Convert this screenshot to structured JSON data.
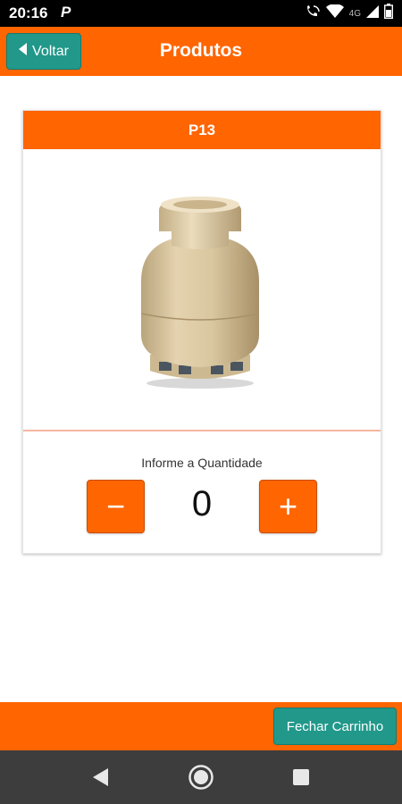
{
  "status_bar": {
    "time": "20:16",
    "app_indicator": "P",
    "network_label": "4G",
    "icons": [
      "wifi-calling-icon",
      "wifi-icon",
      "signal-icon",
      "battery-icon"
    ]
  },
  "header": {
    "back_label": "Voltar",
    "back_icon": "caret-left-icon",
    "title": "Produtos"
  },
  "product": {
    "name": "P13",
    "image": "gas-cylinder-image",
    "quantity_label": "Informe a Quantidade",
    "quantity": "0",
    "minus_symbol": "−",
    "plus_symbol": "+"
  },
  "footer": {
    "close_cart_label": "Fechar Carrinho"
  },
  "nav_bar": {
    "icons": [
      "back-triangle-icon",
      "home-circle-icon",
      "recents-square-icon"
    ]
  },
  "colors": {
    "primary": "#ff6500",
    "accent": "#21988a",
    "status_bar": "#000000",
    "nav_bar": "#3d3d3d"
  }
}
